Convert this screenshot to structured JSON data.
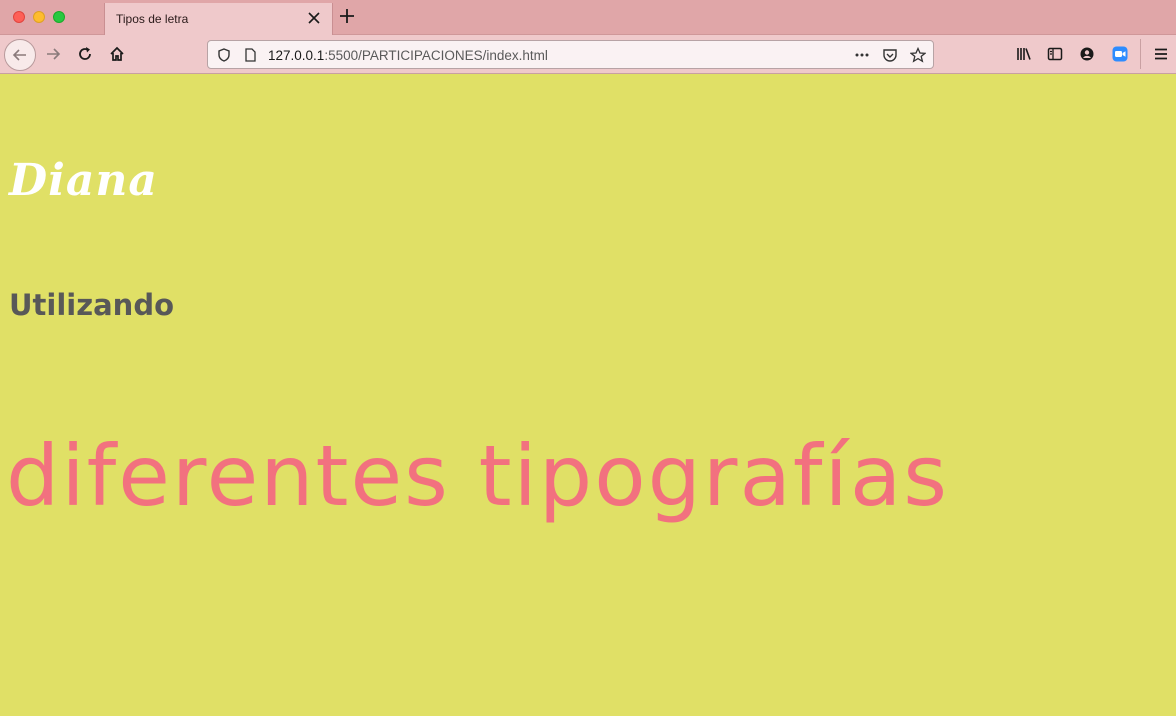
{
  "browser": {
    "tab_title": "Tipos de letra",
    "url_host": "127.0.0.1",
    "url_rest": ":5500/PARTICIPACIONES/index.html"
  },
  "page": {
    "name": "Diana",
    "subtitle": "Utilizando",
    "big_text": "diferentes tipografías"
  },
  "colors": {
    "background": "#e0e066",
    "tabstrip": "#e0a6a8",
    "navbar": "#efc9cb",
    "name_text": "#ffffff",
    "subtitle_text": "#585858",
    "big_text": "#f2717f"
  },
  "icons": [
    "close-traffic-light",
    "minimize-traffic-light",
    "maximize-traffic-light",
    "close-icon",
    "plus-icon",
    "back-arrow-icon",
    "forward-arrow-icon",
    "reload-icon",
    "home-icon",
    "shield-icon",
    "page-icon",
    "more-icon",
    "pocket-icon",
    "star-icon",
    "library-icon",
    "sidebar-icon",
    "account-icon",
    "zoom-icon",
    "menu-icon"
  ]
}
